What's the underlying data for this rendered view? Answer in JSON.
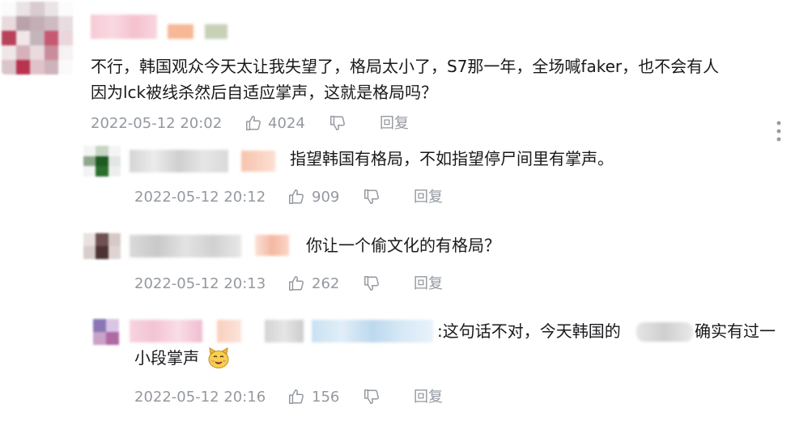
{
  "comments": [
    {
      "text_line1": "不行，韩国观众今天太让我失望了，格局太小了，S7那一年，全场喊faker，也不会有人",
      "text_line2": "因为lck被线杀然后自适应掌声，这就是格局吗？",
      "time": "2022-05-12 20:02",
      "likes": "4024",
      "reply_label": "回复"
    },
    {
      "text": "指望韩国有格局，不如指望停尸间里有掌声。",
      "time": "2022-05-12 20:12",
      "likes": "909",
      "reply_label": "回复"
    },
    {
      "text": "你让一个偷文化的有格局？",
      "time": "2022-05-12 20:13",
      "likes": "262",
      "reply_label": "回复"
    },
    {
      "text_part1": ":这句话不对，今天韩国的",
      "text_part2": "确实有过一",
      "text_line2": "小段掌声",
      "emoji": "cat-face-emoji",
      "time": "2022-05-12 20:16",
      "likes": "156",
      "reply_label": "回复"
    }
  ],
  "icons": {
    "like": "thumbs-up-icon",
    "dislike": "thumbs-down-icon",
    "more": "more-vertical-icon"
  },
  "colors": {
    "text": "#18191c",
    "meta": "#9499a0"
  }
}
